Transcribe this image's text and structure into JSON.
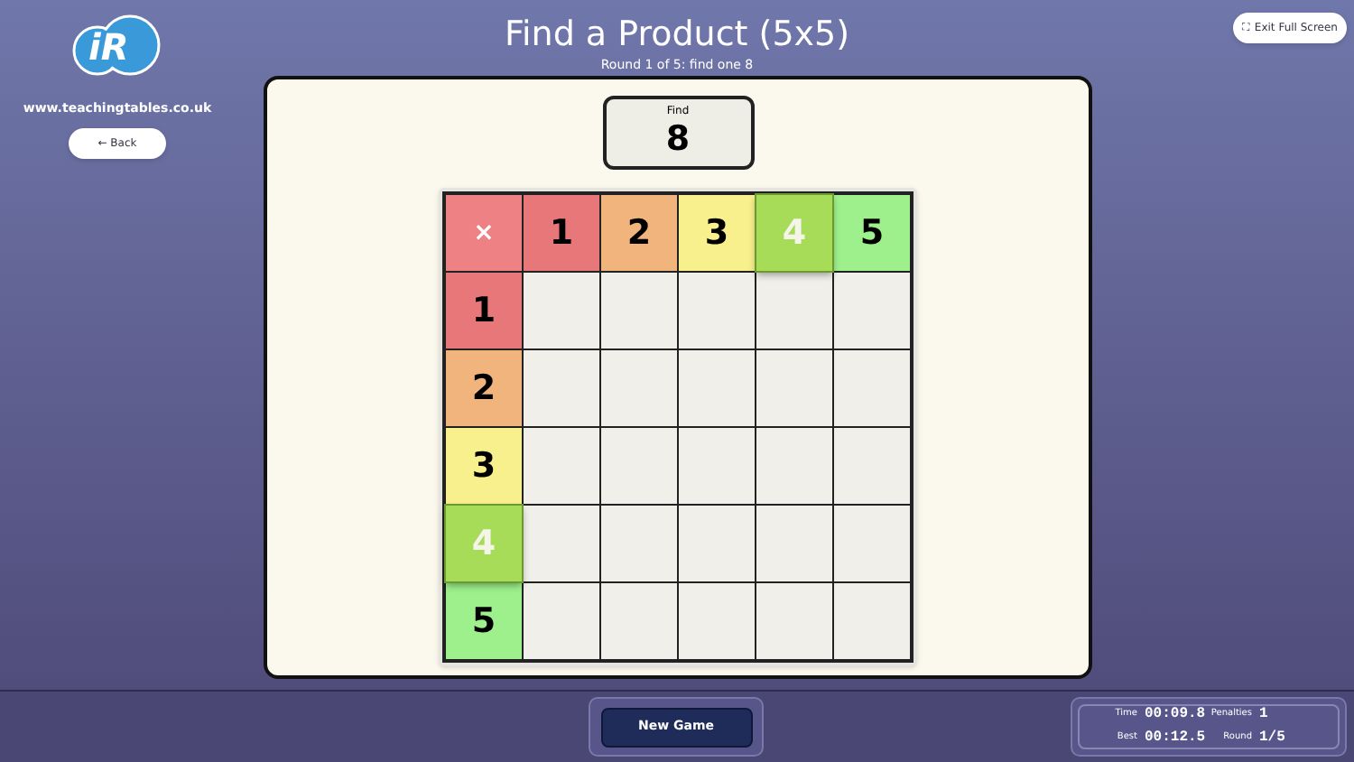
{
  "logo": {
    "text": "iR",
    "site": "www.teachingtables.co.uk"
  },
  "back_button": "← Back",
  "title": "Find a Product (5x5)",
  "subtitle": "Round 1 of 5: find one 8",
  "exit_button": {
    "icon": "⛶",
    "label": "Exit Full Screen"
  },
  "find": {
    "label": "Find",
    "value": "8"
  },
  "grid": {
    "corner": "×",
    "columns": [
      {
        "label": "1",
        "color": "#e8777a",
        "selected": false
      },
      {
        "label": "2",
        "color": "#f0b47c",
        "selected": false
      },
      {
        "label": "3",
        "color": "#f8f08c",
        "selected": false
      },
      {
        "label": "4",
        "color": "#a6dc58",
        "selected": true
      },
      {
        "label": "5",
        "color": "#9ef08c",
        "selected": false
      }
    ],
    "rows": [
      {
        "label": "1",
        "color": "#e8777a",
        "selected": false
      },
      {
        "label": "2",
        "color": "#f0b47c",
        "selected": false
      },
      {
        "label": "3",
        "color": "#f8f08c",
        "selected": false
      },
      {
        "label": "4",
        "color": "#a6dc58",
        "selected": true
      },
      {
        "label": "5",
        "color": "#9ef08c",
        "selected": false
      }
    ]
  },
  "new_game_button": "New Game",
  "stats": [
    {
      "label": "Time",
      "value": "00:09.8"
    },
    {
      "label": "Penalties",
      "value": "1"
    },
    {
      "label": "Best",
      "value": "00:12.5"
    },
    {
      "label": "Round",
      "value": "1/5"
    }
  ]
}
